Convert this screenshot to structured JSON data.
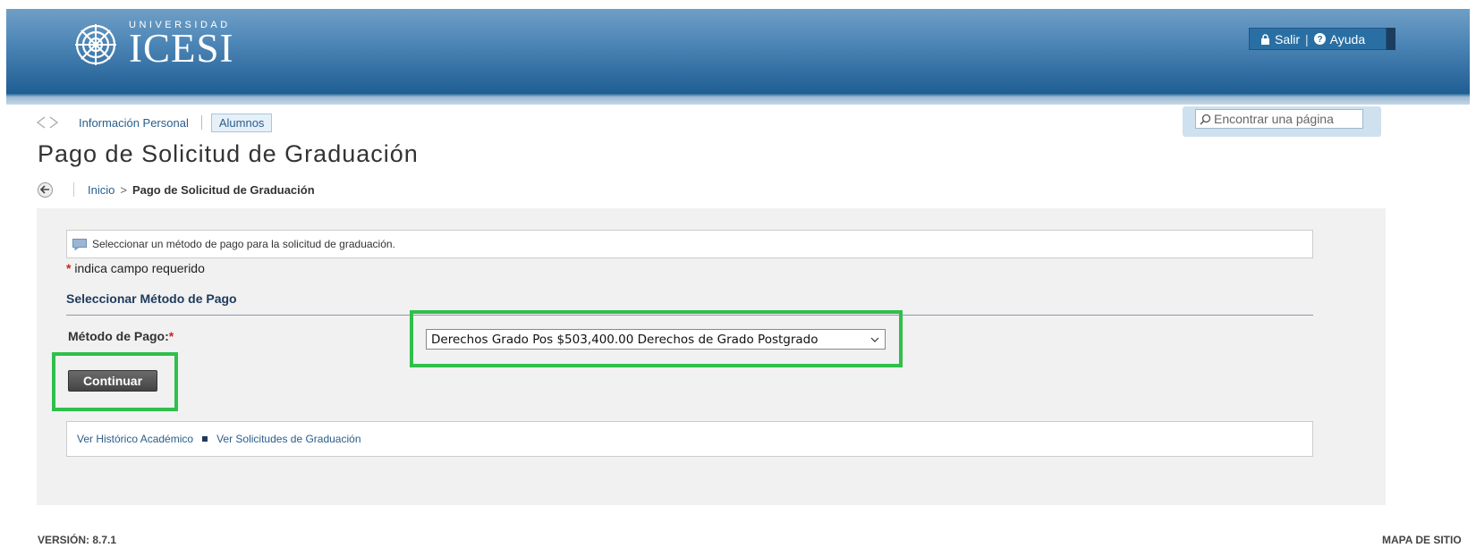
{
  "header": {
    "logo_small": "UNIVERSIDAD",
    "logo_name": "ICESI",
    "logout_label": "Salir",
    "separator": "|",
    "help_label": "Ayuda",
    "lock_icon": "lock-icon",
    "help_icon": "question-circle-icon"
  },
  "nav": {
    "personal_info": "Información Personal",
    "students_tab": "Alumnos"
  },
  "search": {
    "placeholder": "Encontrar una página"
  },
  "page_title": "Pago de Solicitud de Graduación",
  "breadcrumb": {
    "home": "Inicio",
    "sep": ">",
    "current": "Pago de Solicitud de Graduación"
  },
  "form": {
    "info_message": "Seleccionar un método de pago para la solicitud de graduación.",
    "required_star": "*",
    "required_note": " indica campo requerido",
    "section_title": "Seleccionar Método de Pago",
    "payment_label": "Método de Pago:",
    "payment_selected": "Derechos Grado Pos $503,400.00 Derechos de Grado Postgrado",
    "continue_button": "Continuar"
  },
  "links": {
    "academic_history": "Ver Histórico Académico",
    "graduation_requests": "Ver Solicitudes de Graduación"
  },
  "footer": {
    "version": "VERSIÓN: 8.7.1",
    "sitemap": "MAPA DE SITIO"
  },
  "colors": {
    "header_top": "#6f9fc6",
    "header_bottom": "#1f5d93",
    "highlight_green": "#2fbf4b",
    "required_red": "#d1201f",
    "link_blue": "#2a5d8c"
  }
}
